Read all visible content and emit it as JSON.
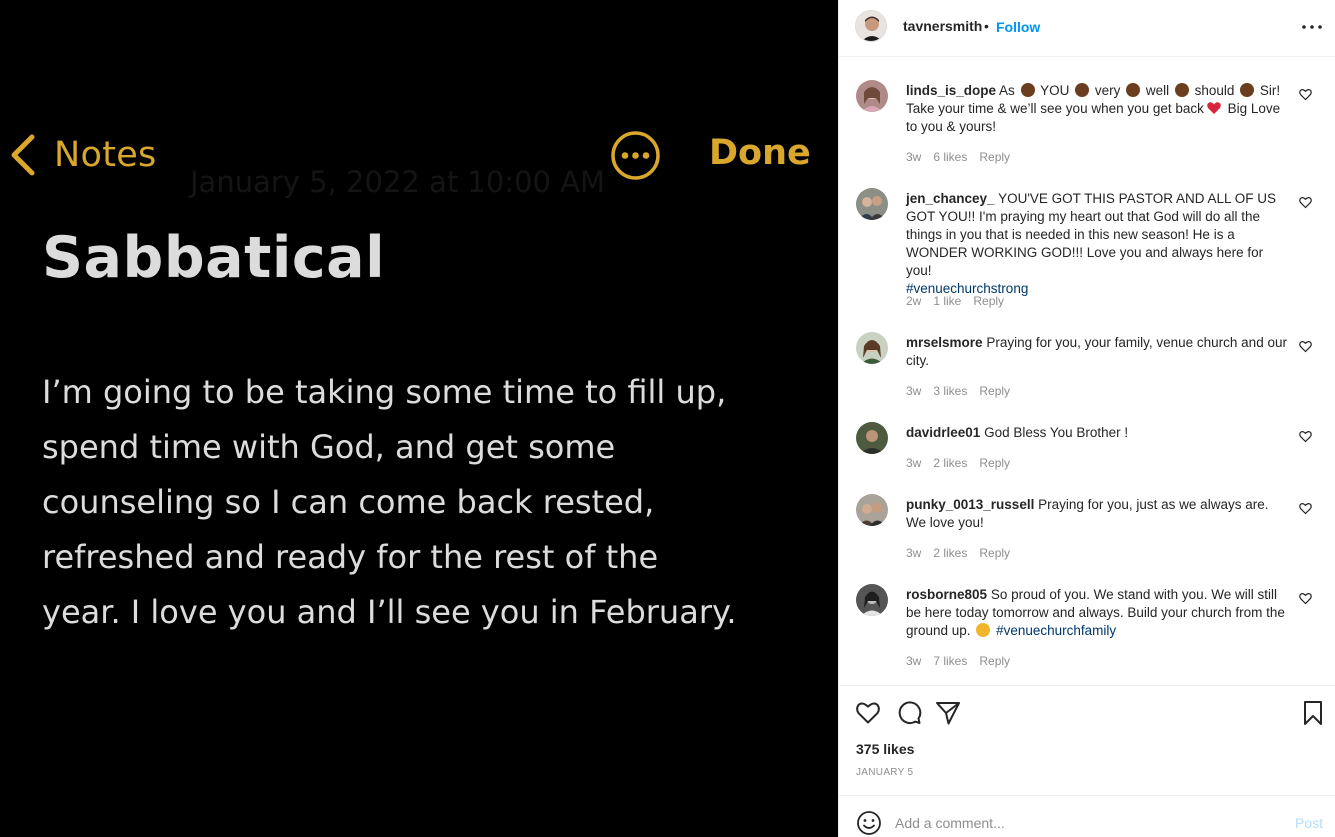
{
  "note": {
    "back_label": "Notes",
    "more_icon": "ellipsis-circle-icon",
    "done_label": "Done",
    "date": "January 5, 2022 at 10:00 AM",
    "title": "Sabbatical",
    "body": "I’m going  to be taking some time to fill up,\nspend time with God, and get some\ncounseling so I can come back rested,\nrefreshed and ready for the rest of the\nyear. I love you and I’ll see you in February.",
    "accent_color": "#d8a72c"
  },
  "header": {
    "username": "tavnersmith",
    "separator": "•",
    "follow_label": "Follow",
    "more_icon": "more-horizontal-icon"
  },
  "comments": [
    {
      "username": "linds_is_dope",
      "parts": [
        "As ",
        "clap",
        " YOU ",
        "clap",
        " very ",
        "clap",
        " well ",
        "clap",
        " should ",
        "clap",
        " Sir! Take your time & we’ll see you when you get back",
        "heart",
        " Big Love to you & yours!"
      ],
      "time": "3w",
      "likes": "6 likes",
      "reply": "Reply"
    },
    {
      "username": "jen_chancey_",
      "text": "YOU'VE GOT THIS PASTOR AND ALL OF US GOT YOU!! I'm praying my heart out that God will do all the things in you that is needed in this new season! He is a WONDER WORKING GOD!!! Love you and always here for you!",
      "hashtag": "#venuechurchstrong",
      "time": "2w",
      "likes": "1 like",
      "reply": "Reply"
    },
    {
      "username": "mrselsmore",
      "text": "Praying for you, your family, venue church and our city.",
      "time": "3w",
      "likes": "3 likes",
      "reply": "Reply"
    },
    {
      "username": "davidrlee01",
      "text": "God Bless You Brother !",
      "time": "3w",
      "likes": "2 likes",
      "reply": "Reply"
    },
    {
      "username": "punky_0013_russell",
      "text": "Praying for you, just as we always are. We love you!",
      "time": "3w",
      "likes": "2 likes",
      "reply": "Reply"
    },
    {
      "username": "rosborne805",
      "text": "So proud of you. We stand with you. We will still be here today tomorrow and always. Build your church from the ground up.",
      "hashtag": "#venuechurchfamily",
      "time": "3w",
      "likes": "7 likes",
      "reply": "Reply"
    }
  ],
  "actions": {
    "like_icon": "heart-icon",
    "comment_icon": "comment-icon",
    "share_icon": "send-icon",
    "save_icon": "bookmark-icon",
    "likes_text": "375 likes",
    "date_text": "JANUARY 5"
  },
  "add_comment": {
    "emoji_icon": "smiley-icon",
    "placeholder": "Add a comment...",
    "post_label": "Post"
  },
  "colors": {
    "link_blue": "#0095f6",
    "hashtag": "#00376b",
    "muted": "#8e8e8e"
  }
}
